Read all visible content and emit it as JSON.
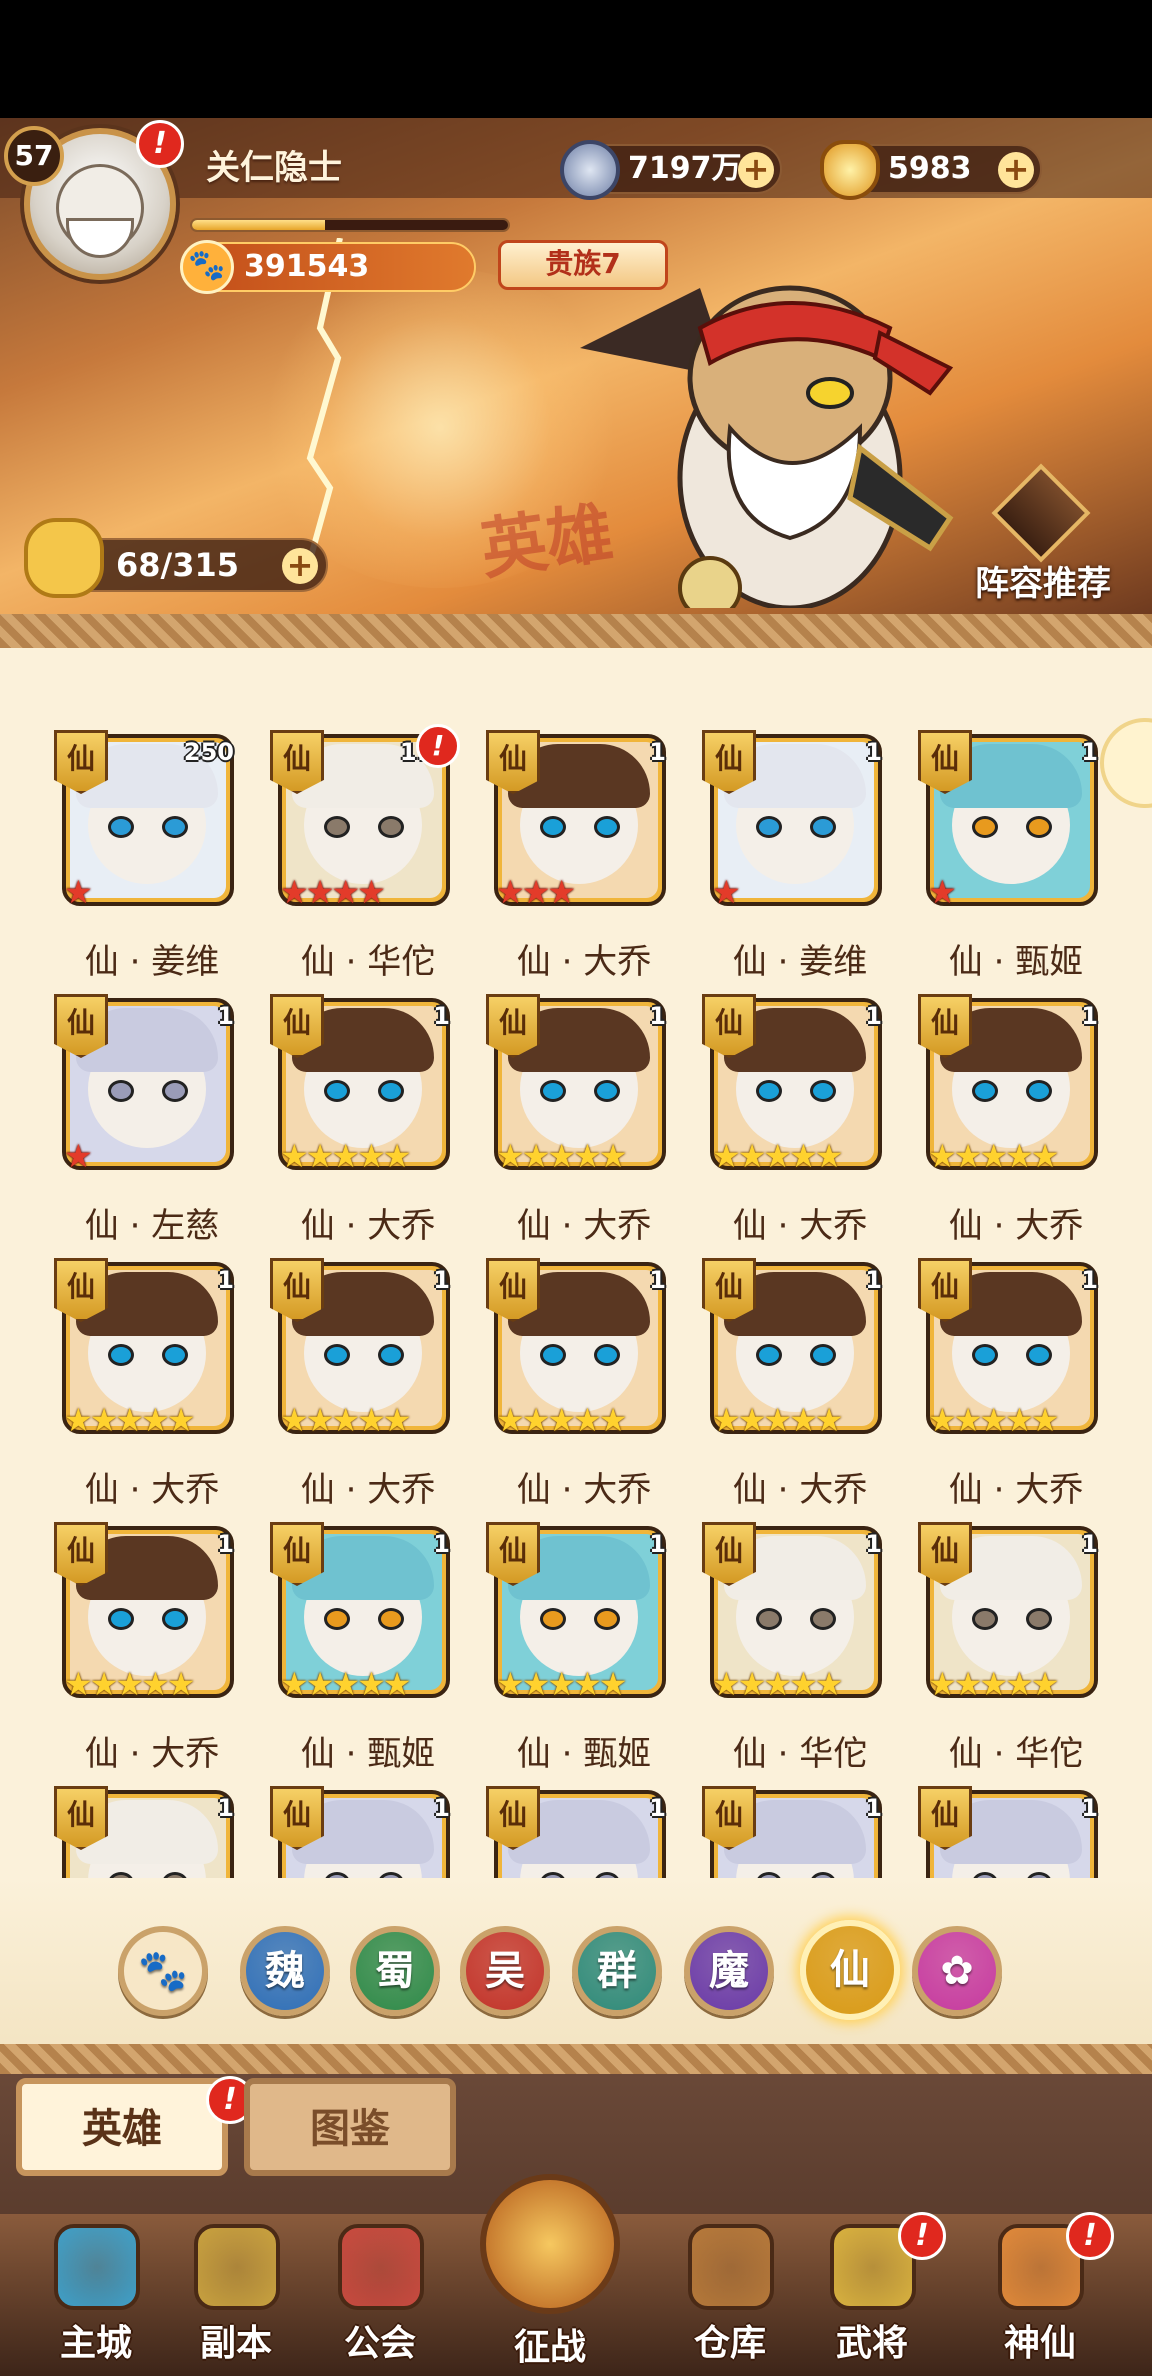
{
  "player": {
    "level": "57",
    "name": "关仁隐士",
    "level_progress": 0.42,
    "copper": "7197万",
    "gold": "5983",
    "power": "391543",
    "noble": "贵族7",
    "stamina": "68/315"
  },
  "banner": {
    "watermark": "英雄",
    "lineup_label": "阵容推荐",
    "alert_mark": "!"
  },
  "heroes": [
    {
      "tag": "仙",
      "level": "250",
      "stars": 1,
      "star_color": "red",
      "name": "仙 · 姜维",
      "alert": false,
      "portrait": "silver"
    },
    {
      "tag": "仙",
      "level": "110",
      "stars": 4,
      "star_color": "red",
      "name": "仙 · 华佗",
      "alert": true,
      "portrait": "elder"
    },
    {
      "tag": "仙",
      "level": "1",
      "stars": 3,
      "star_color": "red",
      "name": "仙 · 大乔",
      "alert": false,
      "portrait": "brown"
    },
    {
      "tag": "仙",
      "level": "1",
      "stars": 1,
      "star_color": "red",
      "name": "仙 · 姜维",
      "alert": false,
      "portrait": "silver"
    },
    {
      "tag": "仙",
      "level": "1",
      "stars": 1,
      "star_color": "red",
      "name": "仙 · 甄姬",
      "alert": false,
      "portrait": "teal"
    },
    {
      "tag": "仙",
      "level": "1",
      "stars": 1,
      "star_color": "red",
      "name": "仙 · 左慈",
      "alert": false,
      "portrait": "grey"
    },
    {
      "tag": "仙",
      "level": "1",
      "stars": 5,
      "star_color": "gold",
      "name": "仙 · 大乔",
      "alert": false,
      "portrait": "brown"
    },
    {
      "tag": "仙",
      "level": "1",
      "stars": 5,
      "star_color": "gold",
      "name": "仙 · 大乔",
      "alert": false,
      "portrait": "brown"
    },
    {
      "tag": "仙",
      "level": "1",
      "stars": 5,
      "star_color": "gold",
      "name": "仙 · 大乔",
      "alert": false,
      "portrait": "brown"
    },
    {
      "tag": "仙",
      "level": "1",
      "stars": 5,
      "star_color": "gold",
      "name": "仙 · 大乔",
      "alert": false,
      "portrait": "brown"
    },
    {
      "tag": "仙",
      "level": "1",
      "stars": 5,
      "star_color": "gold",
      "name": "仙 · 大乔",
      "alert": false,
      "portrait": "brown"
    },
    {
      "tag": "仙",
      "level": "1",
      "stars": 5,
      "star_color": "gold",
      "name": "仙 · 大乔",
      "alert": false,
      "portrait": "brown"
    },
    {
      "tag": "仙",
      "level": "1",
      "stars": 5,
      "star_color": "gold",
      "name": "仙 · 大乔",
      "alert": false,
      "portrait": "brown"
    },
    {
      "tag": "仙",
      "level": "1",
      "stars": 5,
      "star_color": "gold",
      "name": "仙 · 大乔",
      "alert": false,
      "portrait": "brown"
    },
    {
      "tag": "仙",
      "level": "1",
      "stars": 5,
      "star_color": "gold",
      "name": "仙 · 大乔",
      "alert": false,
      "portrait": "brown"
    },
    {
      "tag": "仙",
      "level": "1",
      "stars": 5,
      "star_color": "gold",
      "name": "仙 · 大乔",
      "alert": false,
      "portrait": "brown"
    },
    {
      "tag": "仙",
      "level": "1",
      "stars": 5,
      "star_color": "gold",
      "name": "仙 · 甄姬",
      "alert": false,
      "portrait": "teal"
    },
    {
      "tag": "仙",
      "level": "1",
      "stars": 5,
      "star_color": "gold",
      "name": "仙 · 甄姬",
      "alert": false,
      "portrait": "teal"
    },
    {
      "tag": "仙",
      "level": "1",
      "stars": 5,
      "star_color": "gold",
      "name": "仙 · 华佗",
      "alert": false,
      "portrait": "elder"
    },
    {
      "tag": "仙",
      "level": "1",
      "stars": 5,
      "star_color": "gold",
      "name": "仙 · 华佗",
      "alert": false,
      "portrait": "elder"
    },
    {
      "tag": "仙",
      "level": "1",
      "stars": 0,
      "star_color": "gold",
      "name": "",
      "alert": false,
      "portrait": "elder"
    },
    {
      "tag": "仙",
      "level": "1",
      "stars": 0,
      "star_color": "gold",
      "name": "",
      "alert": false,
      "portrait": "grey"
    },
    {
      "tag": "仙",
      "level": "1",
      "stars": 0,
      "star_color": "gold",
      "name": "",
      "alert": false,
      "portrait": "grey"
    },
    {
      "tag": "仙",
      "level": "1",
      "stars": 0,
      "star_color": "gold",
      "name": "",
      "alert": false,
      "portrait": "grey"
    },
    {
      "tag": "仙",
      "level": "1",
      "stars": 0,
      "star_color": "gold",
      "name": "",
      "alert": false,
      "portrait": "grey"
    }
  ],
  "factions": [
    {
      "label": "",
      "icon": "paw-icon",
      "color": "#8a5a2e",
      "active": false
    },
    {
      "label": "魏",
      "icon": "wei-faction-icon",
      "color": "#2f6fb8",
      "active": false
    },
    {
      "label": "蜀",
      "icon": "shu-faction-icon",
      "color": "#2f8a4a",
      "active": false
    },
    {
      "label": "吴",
      "icon": "wu-faction-icon",
      "color": "#c2332a",
      "active": false
    },
    {
      "label": "群",
      "icon": "qun-faction-icon",
      "color": "#2f8a7a",
      "active": false
    },
    {
      "label": "魔",
      "icon": "mo-faction-icon",
      "color": "#6a3aa8",
      "active": false
    },
    {
      "label": "仙",
      "icon": "xian-faction-icon",
      "color": "#d99a16",
      "active": true
    },
    {
      "label": "",
      "icon": "special-faction-icon",
      "color": "#c63aa0",
      "active": false
    }
  ],
  "tabs": {
    "heroes": "英雄",
    "codex": "图鉴"
  },
  "nav": [
    {
      "label": "主城",
      "icon": "castle-icon",
      "color": "#3fa0c9",
      "alert": false
    },
    {
      "label": "副本",
      "icon": "sword-icon",
      "color": "#c9a23f",
      "alert": false
    },
    {
      "label": "公会",
      "icon": "banner-flag-icon",
      "color": "#c94a3f",
      "alert": false
    },
    {
      "label": "征战",
      "icon": "battle-icon",
      "color": "#d9902a",
      "alert": false
    },
    {
      "label": "仓库",
      "icon": "bag-icon",
      "color": "#b6793a",
      "alert": false
    },
    {
      "label": "武将",
      "icon": "hero-cat-icon",
      "color": "#d9b23f",
      "alert": true
    },
    {
      "label": "神仙",
      "icon": "tabby-cat-icon",
      "color": "#e0893a",
      "alert": true
    }
  ]
}
